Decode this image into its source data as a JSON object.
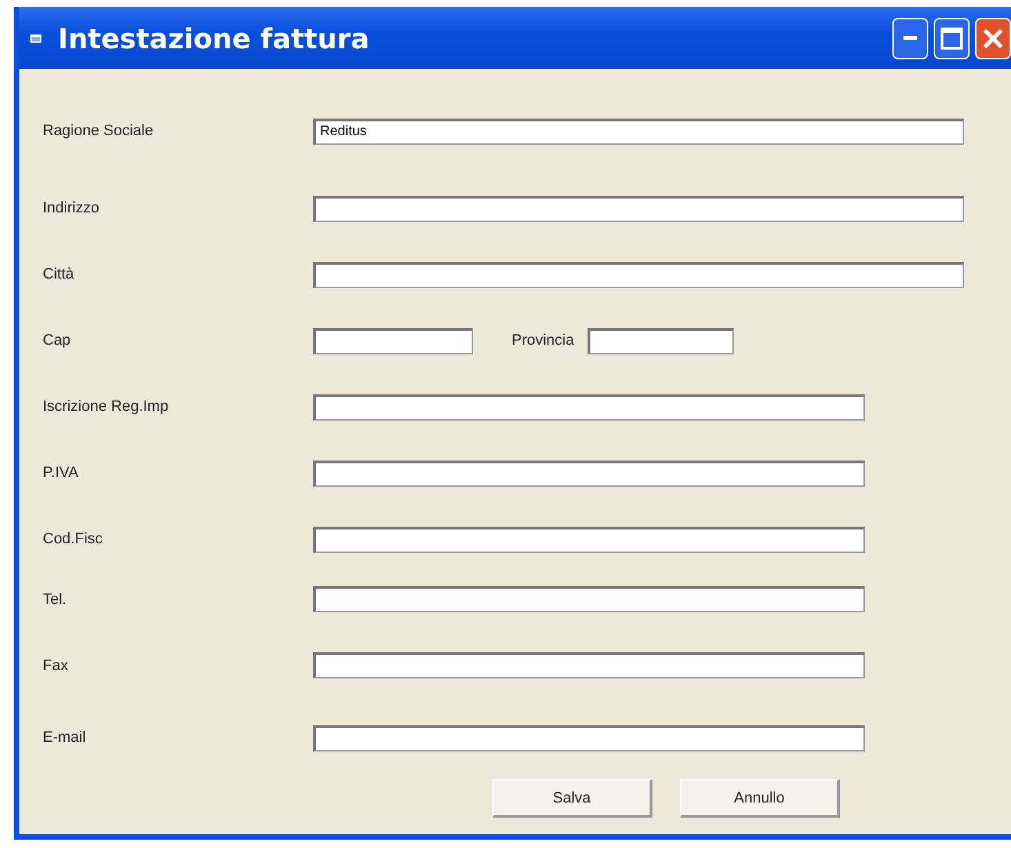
{
  "window": {
    "title": "Intestazione fattura"
  },
  "rows": [
    {
      "kind": "wide",
      "label": "Ragione Sociale",
      "value": "Reditus"
    },
    {
      "kind": "wide",
      "label": "Indirizzo"
    },
    {
      "kind": "wide",
      "label": "Città"
    },
    {
      "kind": "pair",
      "label": "Cap",
      "second_label": "Provincia"
    },
    {
      "kind": "medium",
      "label": "Iscrizione Reg.Imp"
    },
    {
      "kind": "medium",
      "label": "P.IVA"
    },
    {
      "kind": "medium",
      "label": "Cod.Fisc"
    },
    {
      "kind": "medium",
      "label": "Tel."
    },
    {
      "kind": "medium",
      "label": "Fax"
    },
    {
      "kind": "medium",
      "label": "E-mail"
    }
  ],
  "buttons": [
    "Salva",
    "Annullo"
  ]
}
